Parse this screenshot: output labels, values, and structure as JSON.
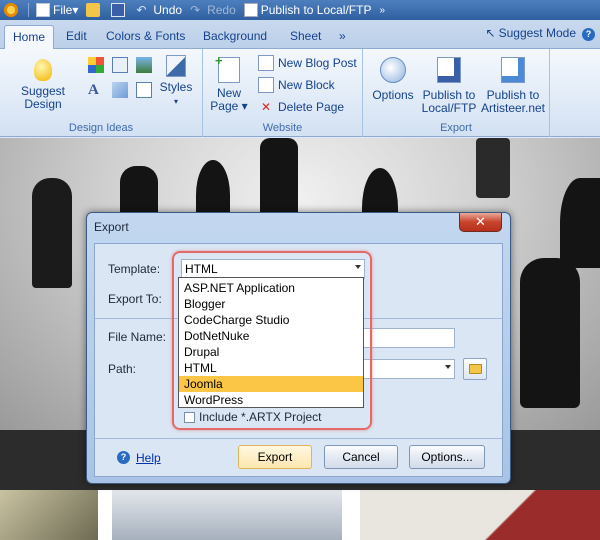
{
  "qat": {
    "file": "File",
    "undo": "Undo",
    "redo": "Redo",
    "publish": "Publish to Local/FTP"
  },
  "tabs": [
    "Home",
    "Edit",
    "Colors & Fonts",
    "Background",
    "Sheet",
    "»"
  ],
  "suggest_mode": "Suggest Mode",
  "ribbon": {
    "design_ideas": {
      "suggest_design": "Suggest Design",
      "styles": "Styles",
      "label": "Design Ideas"
    },
    "website": {
      "new_page": "New",
      "new_page2": "Page ▾",
      "new_blog_post": "New Blog Post",
      "new_block": "New Block",
      "delete_page": "Delete Page",
      "label": "Website"
    },
    "export": {
      "options": "Options",
      "publish_local": "Publish to",
      "publish_local2": "Local/FTP",
      "publish_artisteer": "Publish to",
      "publish_artisteer2": "Artisteer.net",
      "label": "Export"
    }
  },
  "dialog": {
    "title": "Export",
    "close": "✕",
    "template_label": "Template:",
    "template_value": "HTML",
    "export_to_label": "Export To:",
    "file_name_label": "File Name:",
    "path_label": "Path:",
    "include_artx": "Include *.ARTX Project",
    "help": "Help",
    "export_button": "Export",
    "cancel_button": "Cancel",
    "options_button": "Options..."
  },
  "dropdown": {
    "options": [
      "ASP.NET Application",
      "Blogger",
      "CodeCharge Studio",
      "DotNetNuke",
      "Drupal",
      "HTML",
      "Joomla",
      "WordPress"
    ],
    "highlighted": "Joomla"
  },
  "colors": {
    "highlight": "#fbc646",
    "annotation_ring": "#e36a6a",
    "ribbon_text": "#15428b"
  }
}
